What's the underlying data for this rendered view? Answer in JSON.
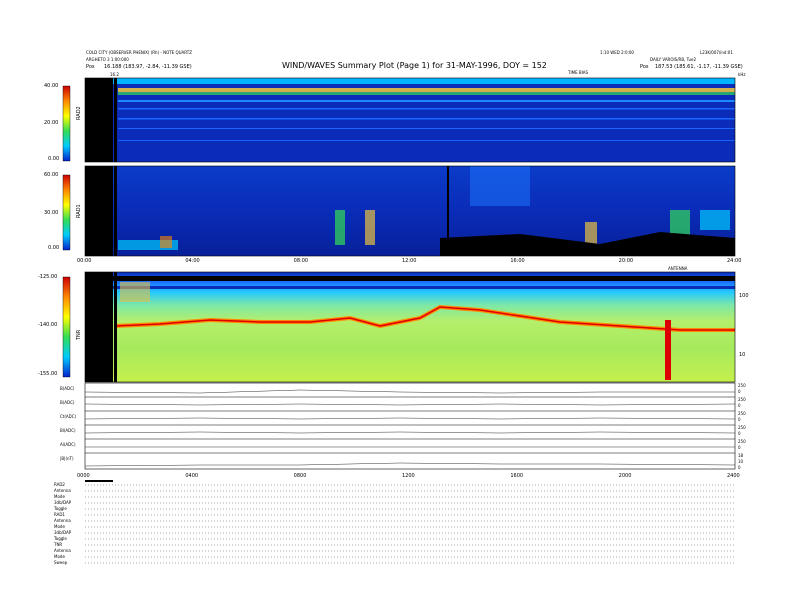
{
  "header": {
    "left_line1": "COLD CITY (OBSERVER PHENIX) (Rh) - NOTE QUARTZ",
    "left_line2": "ARGHETO 3 1:00:000",
    "pos_label_left": "Pos",
    "pos_value_left": "16.188 (183.97, -2.84, -11.39 GSE)",
    "title": "WIND/WAVES Summary Plot (Page 1) for 31-MAY-1996, DOY = 152",
    "right_top1": "1:10 WED 2:0:00",
    "right_top2": "L23K/007/ind:01",
    "right_line2": "DAILY VAROIS/RB, Tue2",
    "pos_label_right": "Pos",
    "pos_value_right": "187.53 (185.61, -1.17, -11.39 GSE)",
    "right_marker": "TIME BIAS",
    "left_marker": "16.2",
    "right_small": "kHz"
  },
  "panels": [
    {
      "name": "RAD2",
      "ticks": [
        "40.00",
        "20.00",
        "0.00"
      ]
    },
    {
      "name": "RAD1",
      "ticks": [
        "60.00",
        "30.00",
        "0.00"
      ]
    },
    {
      "name": "TNR",
      "ticks": [
        "-125.00",
        "-140.00",
        "-155.00"
      ],
      "right_ticks": [
        "100",
        "10"
      ],
      "marker": "ANTENNA"
    }
  ],
  "time_axis": {
    "labels": [
      "00:00",
      "04:00",
      "08:00",
      "12:00",
      "16:00",
      "20:00",
      "24:00"
    ],
    "bottom_labels": [
      "0000",
      "0400",
      "0800",
      "1200",
      "1600",
      "2000",
      "2400"
    ]
  },
  "strips": [
    {
      "label": "B(ADC)",
      "right": [
        "250",
        "0"
      ]
    },
    {
      "label": "B(ADC)",
      "right": [
        "250",
        "0"
      ]
    },
    {
      "label": "Ct(ADC)",
      "right": [
        "250",
        "0"
      ]
    },
    {
      "label": "Bl(ADC)",
      "right": [
        "250",
        "0"
      ]
    },
    {
      "label": "Al(ADC)",
      "right": [
        "250",
        "0"
      ]
    },
    {
      "label": "|B|(nT)",
      "right": [
        "18",
        "10",
        "0"
      ]
    }
  ],
  "status_rows": [
    "RAD2",
    "Antenna",
    "Mode",
    "3db/DAP",
    "Toggle",
    "RAD1",
    "Antenna",
    "Mode",
    "3db/DAP",
    "Toggle",
    "TNR",
    "Antenna",
    "Mode",
    "Sweep"
  ],
  "colors": {
    "background": "#0a2cb8",
    "band": "#e8c040",
    "colorbar": [
      "#cc0000",
      "#ff8800",
      "#ffff00",
      "#33dd55",
      "#00ccff",
      "#0022cc"
    ]
  },
  "chart_data": {
    "type": "heatmap",
    "title": "WIND/WAVES Summary Plot (Page 1) for 31-MAY-1996, DOY = 152",
    "x": {
      "label": "",
      "range": [
        "00:00",
        "24:00"
      ]
    },
    "panels": [
      "RAD2",
      "RAD1",
      "TNR"
    ],
    "rad2_range": [
      0,
      40
    ],
    "rad1_range": [
      0,
      60
    ],
    "tnr_range": [
      -155,
      -125
    ]
  }
}
